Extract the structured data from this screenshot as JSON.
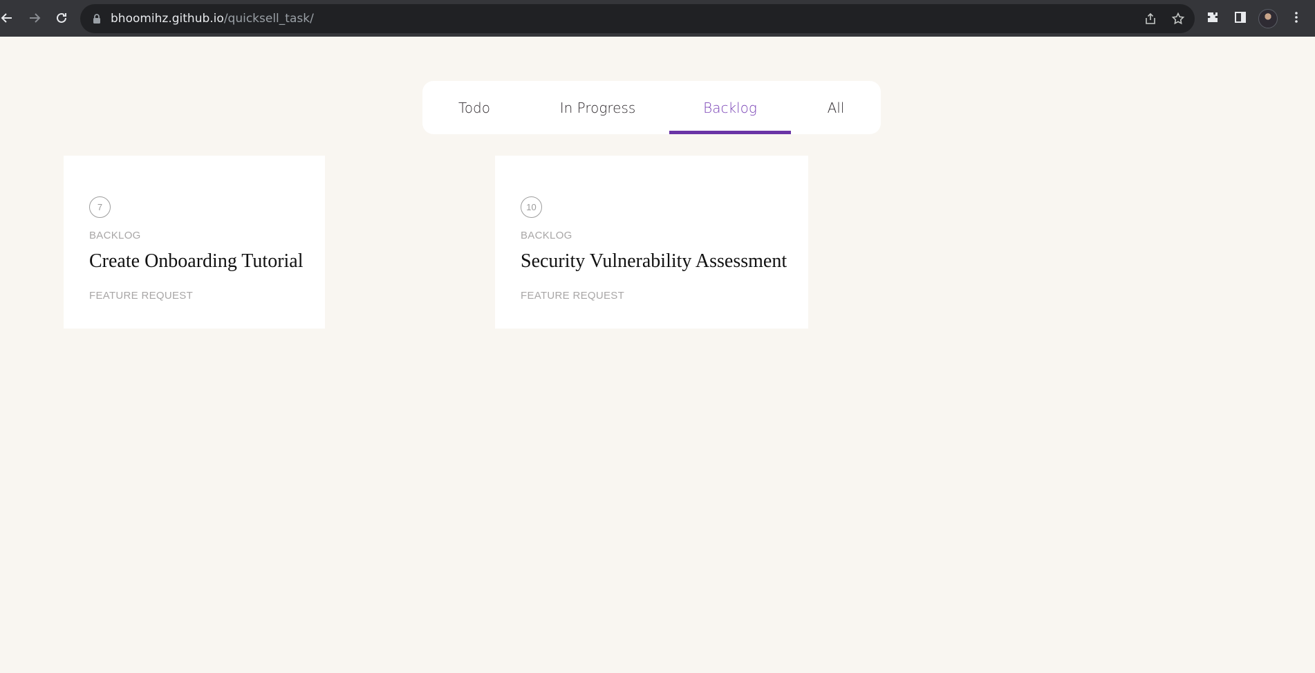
{
  "browser": {
    "url_host": "bhoomihz.github.io",
    "url_path": "/quicksell_task/"
  },
  "tabs": [
    {
      "label": "Todo",
      "active": false
    },
    {
      "label": "In Progress",
      "active": false
    },
    {
      "label": "Backlog",
      "active": true
    },
    {
      "label": "All",
      "active": false
    }
  ],
  "cards": [
    {
      "id": "7",
      "status": "BACKLOG",
      "title": "Create Onboarding Tutorial",
      "tag": "FEATURE REQUEST"
    },
    {
      "id": "10",
      "status": "BACKLOG",
      "title": "Security Vulnerability Assessment",
      "tag": "FEATURE REQUEST"
    }
  ],
  "colors": {
    "accent": "#6a35a6",
    "background": "#f9f6f1"
  }
}
